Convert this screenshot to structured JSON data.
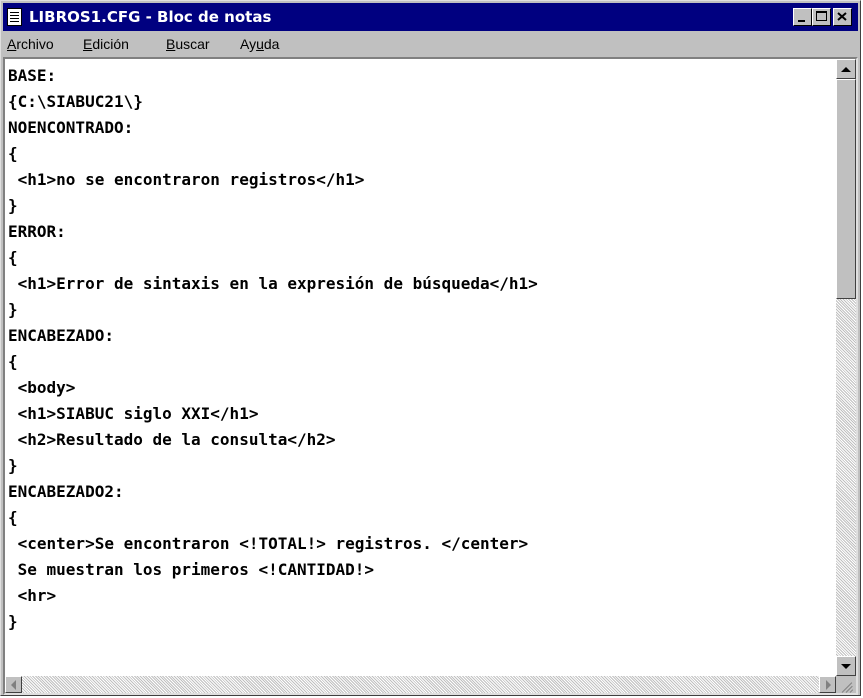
{
  "window": {
    "title": "LIBROS1.CFG - Bloc de notas",
    "titlebar_color": "#000080",
    "icon": "notepad-icon"
  },
  "menu": [
    {
      "accel": "A",
      "rest": "rchivo"
    },
    {
      "accel": "E",
      "rest": "dición"
    },
    {
      "accel": "B",
      "rest": "uscar"
    },
    {
      "pre": "Ay",
      "accel": "u",
      "rest": "da"
    }
  ],
  "editor": {
    "lines": [
      "BASE:",
      "{C:\\SIABUC21\\}",
      "NOENCONTRADO:",
      "{",
      " <h1>no se encontraron registros</h1>",
      "}",
      "ERROR:",
      "{",
      " <h1>Error de sintaxis en la expresión de búsqueda</h1>",
      "}",
      "ENCABEZADO:",
      "{",
      " <body>",
      " <h1>SIABUC siglo XXI</h1>",
      " <h2>Resultado de la consulta</h2>",
      "}",
      "ENCABEZADO2:",
      "{",
      " <center>Se encontraron <!TOTAL!> registros. </center>",
      " Se muestran los primeros <!CANTIDAD!>",
      " <hr>",
      "}"
    ]
  },
  "scrollbars": {
    "vertical_position": 0,
    "horizontal_position": 0
  }
}
